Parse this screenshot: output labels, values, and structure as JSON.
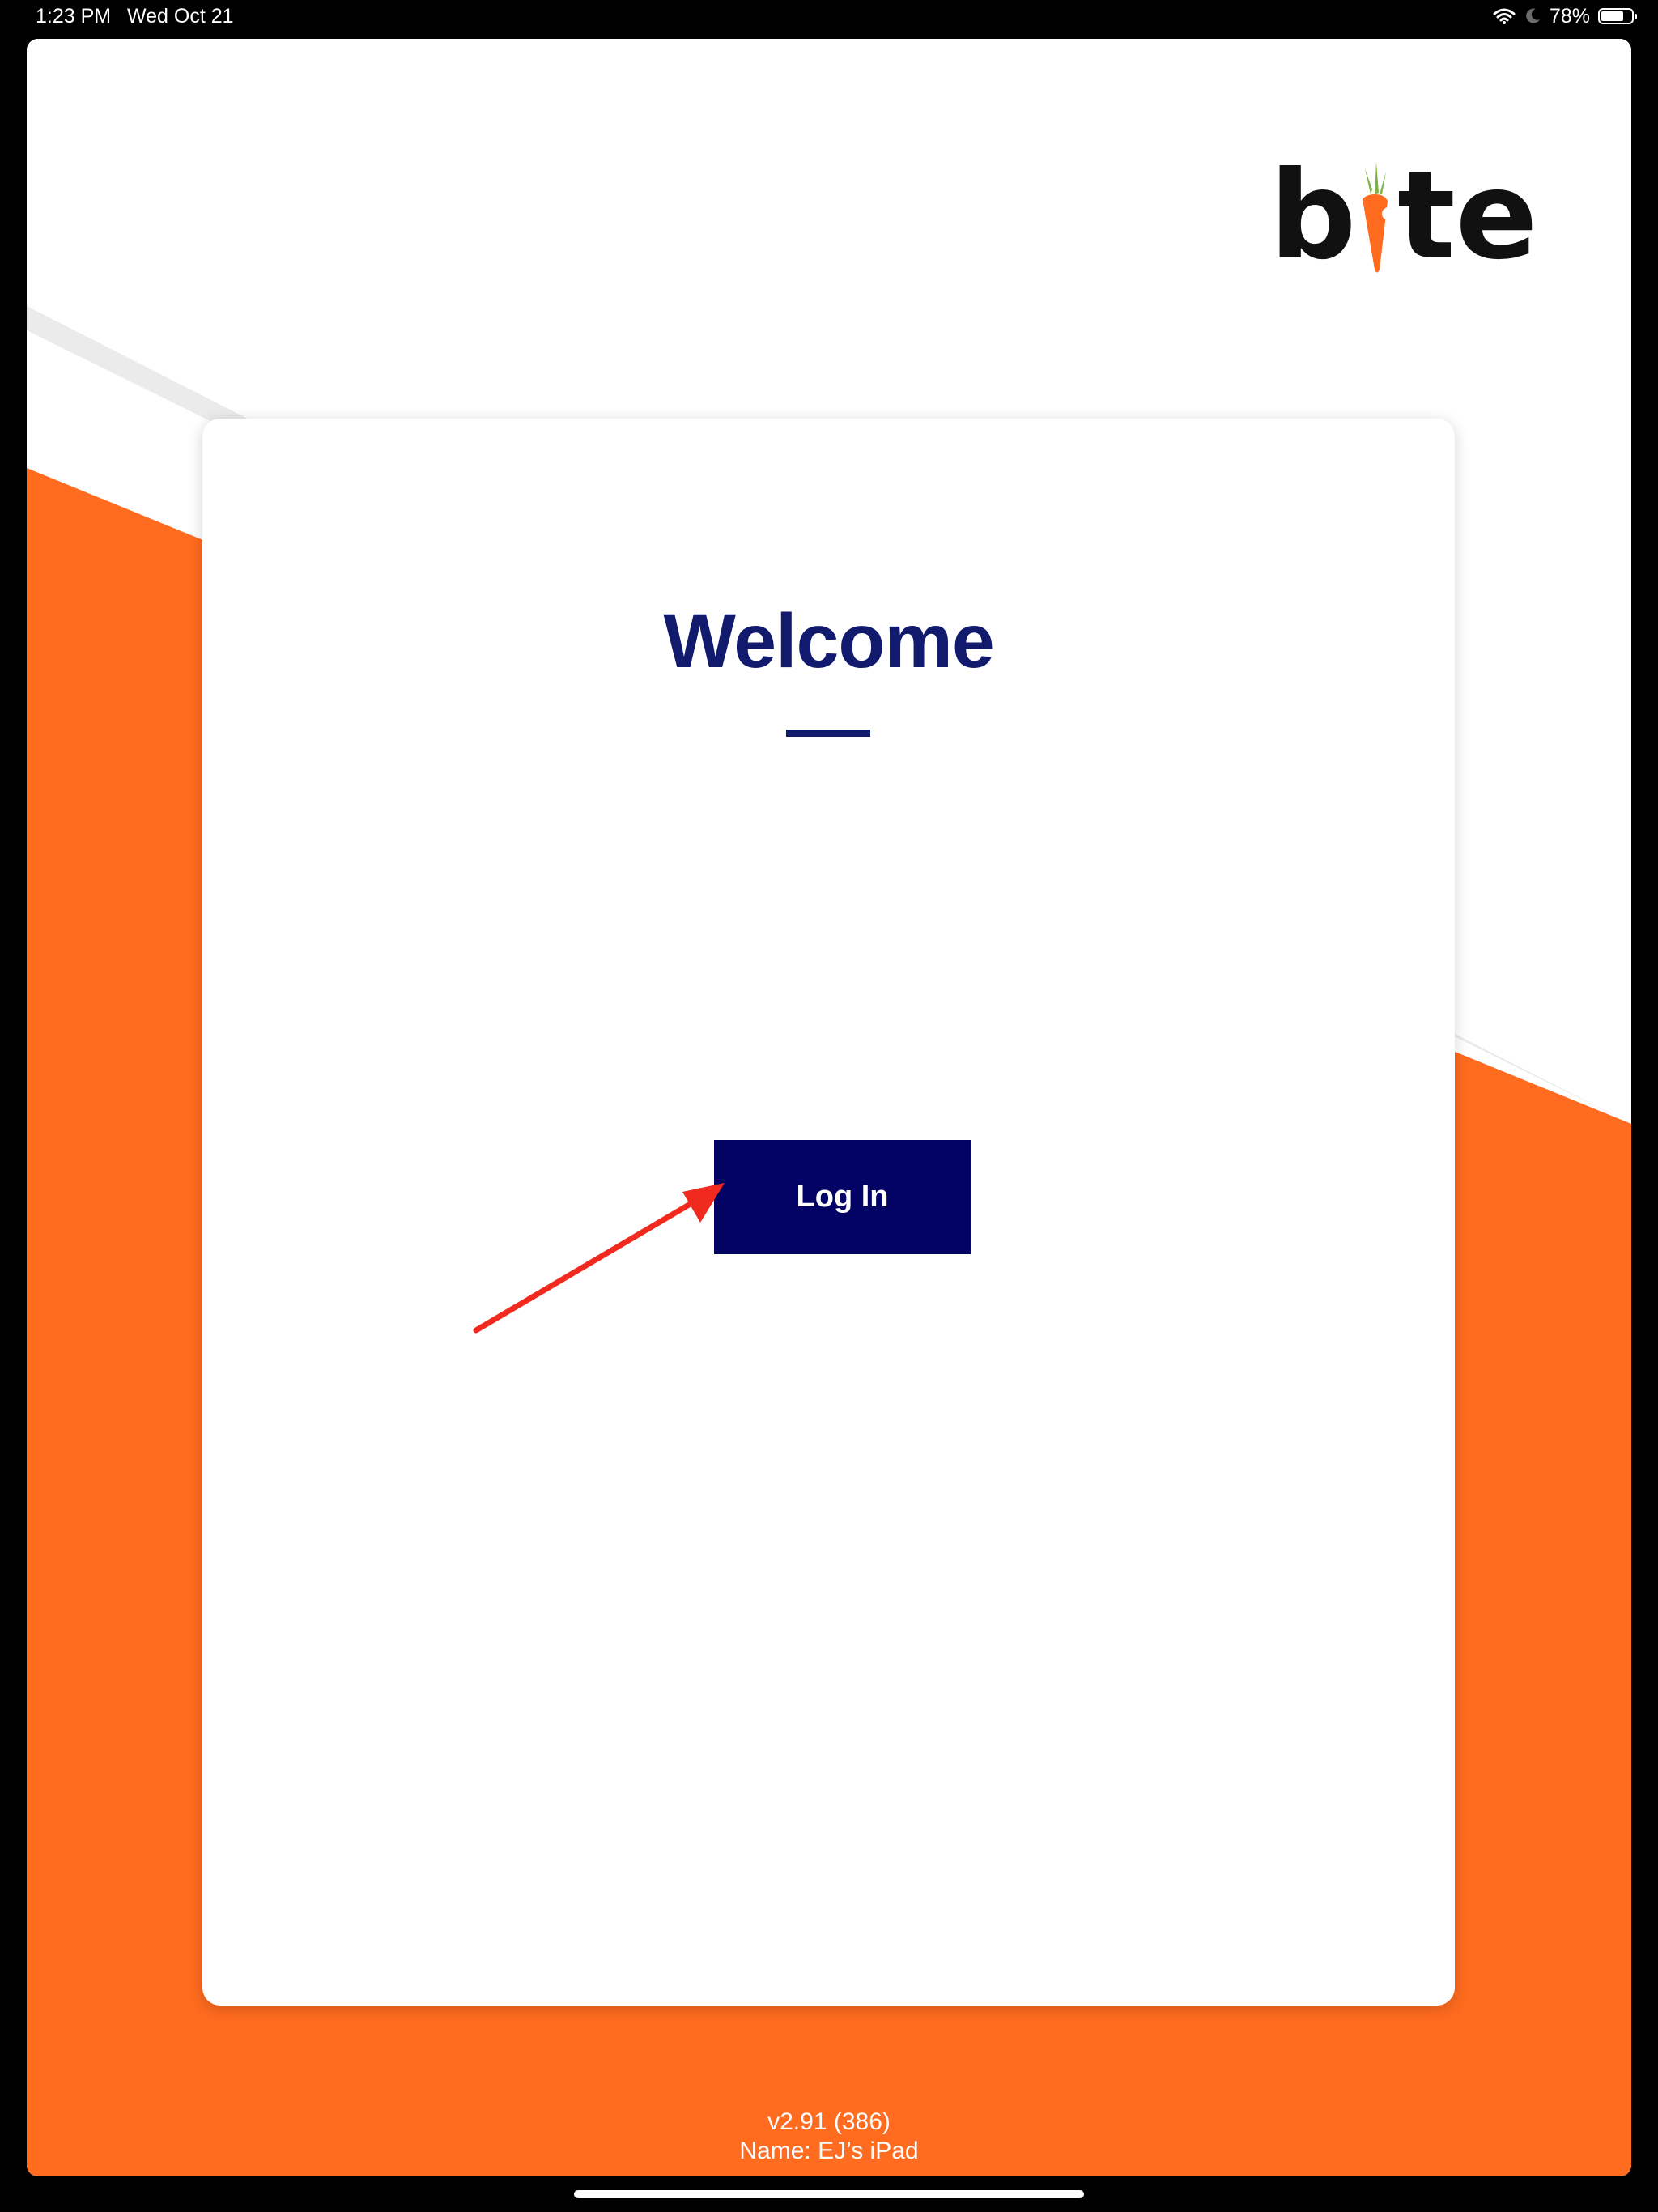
{
  "status_bar": {
    "time": "1:23 PM",
    "date": "Wed Oct 21",
    "battery": "78%",
    "battery_level": 0.78,
    "icons": [
      "wifi-icon",
      "moon-icon",
      "battery-icon"
    ]
  },
  "app": {
    "logo_text": "bite",
    "welcome_title": "Welcome",
    "login_label": "Log In",
    "version": "v2.91 (386)",
    "device_name": "Name: EJ’s iPad"
  },
  "colors": {
    "brand_orange": "#ff6b1f",
    "navy_title": "#121a6e",
    "button_navy": "#030366",
    "annotation_red": "#f02a1e",
    "carrot_green": "#7cb342"
  }
}
